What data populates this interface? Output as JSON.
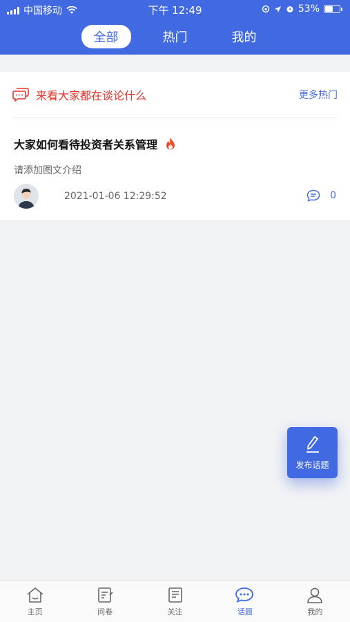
{
  "status_bar": {
    "carrier": "中国移动",
    "time": "下午 12:49",
    "battery": "53%",
    "battery_level": 0.53
  },
  "top_tabs": [
    {
      "label": "全部",
      "active": true
    },
    {
      "label": "热门",
      "active": false
    },
    {
      "label": "我的",
      "active": false
    }
  ],
  "hot_section": {
    "title": "来看大家都在谈论什么",
    "more_label": "更多热门"
  },
  "topic": {
    "title": "大家如何看待投资者关系管理",
    "description": "请添加图文介绍",
    "date": "2021-01-06 12:29:52",
    "comment_count": "0"
  },
  "fab": {
    "label": "发布话题"
  },
  "bottom_nav": [
    {
      "label": "主页",
      "icon": "home-icon",
      "active": false
    },
    {
      "label": "问卷",
      "icon": "survey-icon",
      "active": false
    },
    {
      "label": "关注",
      "icon": "follow-icon",
      "active": false
    },
    {
      "label": "话题",
      "icon": "chat-icon",
      "active": true
    },
    {
      "label": "我的",
      "icon": "user-icon",
      "active": false
    }
  ],
  "colors": {
    "brand": "#4169e1",
    "hot_red": "#e6332a",
    "background": "#f2f3f5"
  }
}
